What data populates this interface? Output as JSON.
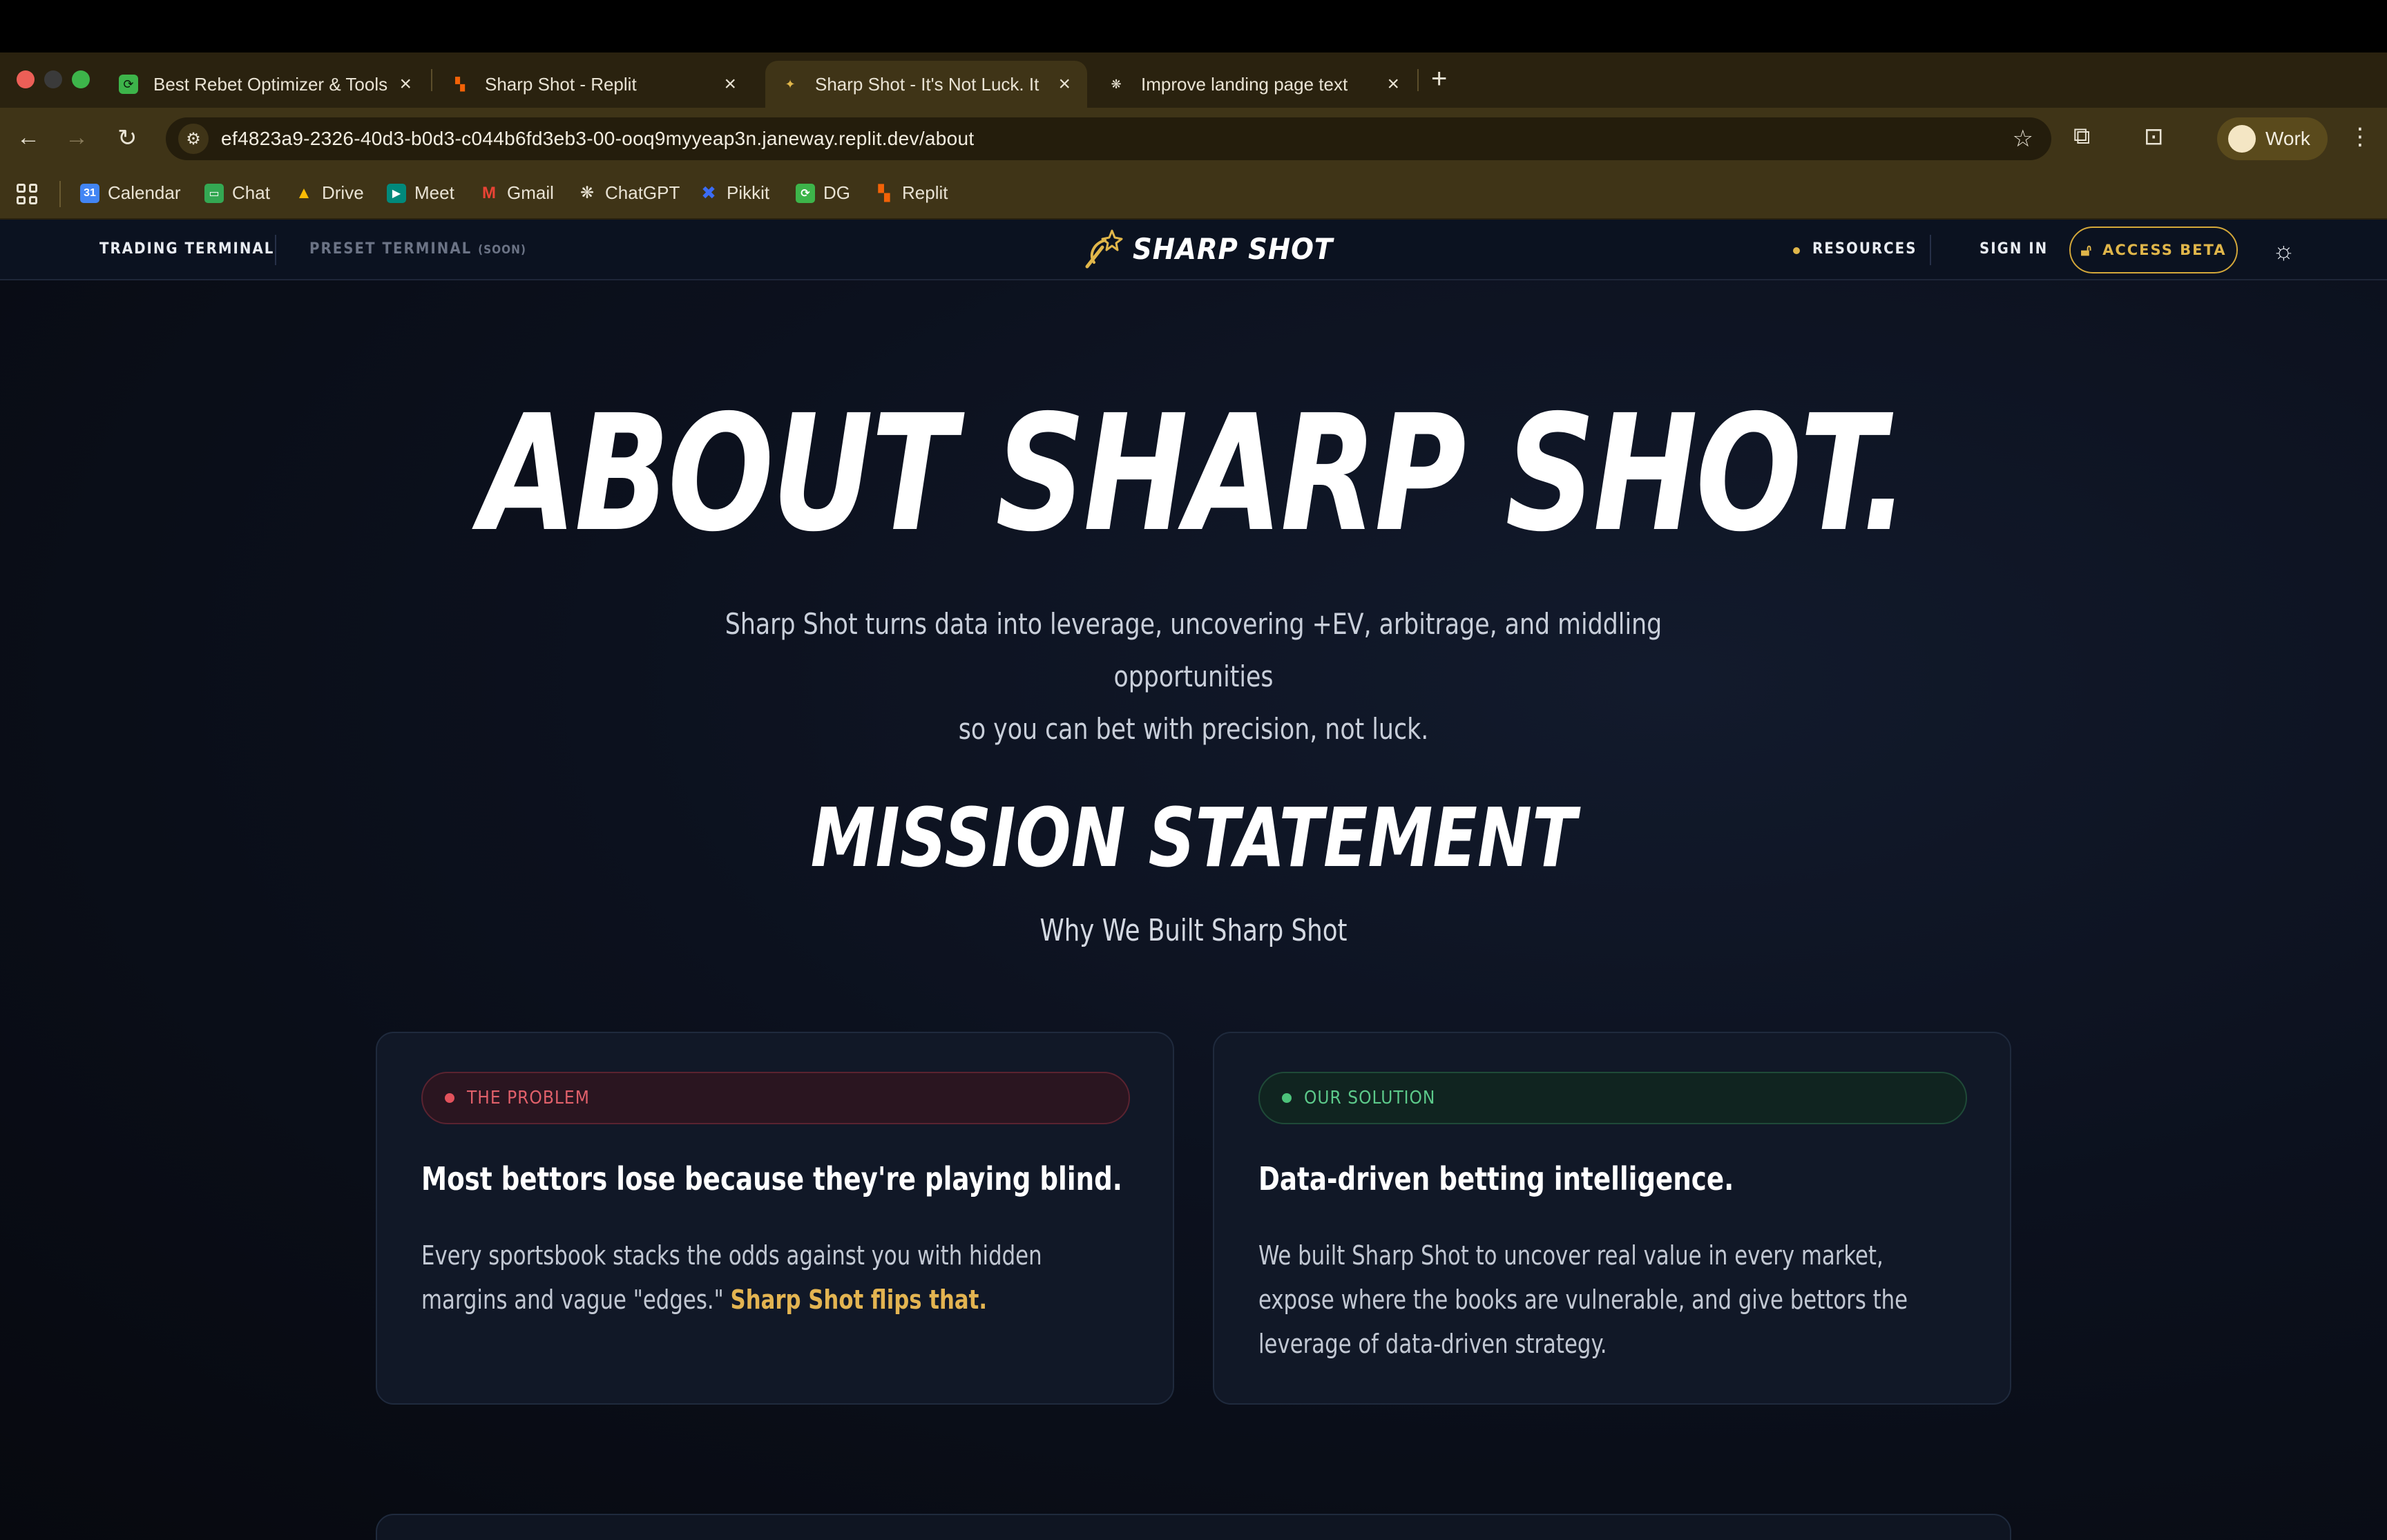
{
  "browser": {
    "tabs": [
      {
        "label": "Best Rebet Optimizer & Tools",
        "favicon": "rebet-favicon",
        "active": false
      },
      {
        "label": "Sharp Shot - Replit",
        "favicon": "replit-favicon",
        "active": false
      },
      {
        "label": "Sharp Shot - It's Not Luck. It",
        "favicon": "sharp-shot-favicon",
        "active": true
      },
      {
        "label": "Improve landing page text",
        "favicon": "chatgpt-favicon",
        "active": false
      }
    ],
    "url": "ef4823a9-2326-40d3-b0d3-c044b6fd3eb3-00-ooq9myyeap3n.janeway.replit.dev/about",
    "profile_label": "Work",
    "bookmarks": [
      {
        "label": "Calendar",
        "icon": "calendar-icon",
        "color": "#4285f4"
      },
      {
        "label": "Chat",
        "icon": "chat-icon",
        "color": "#34a853"
      },
      {
        "label": "Drive",
        "icon": "drive-icon",
        "color": "#fbbc04"
      },
      {
        "label": "Meet",
        "icon": "meet-icon",
        "color": "#00897b"
      },
      {
        "label": "Gmail",
        "icon": "gmail-icon",
        "color": "#ea4335"
      },
      {
        "label": "ChatGPT",
        "icon": "chatgpt-icon",
        "color": "#cccccc"
      },
      {
        "label": "Pikkit",
        "icon": "pikkit-icon",
        "color": "#3b6cf5"
      },
      {
        "label": "DG",
        "icon": "dg-icon",
        "color": "#3db44a"
      },
      {
        "label": "Replit",
        "icon": "replit-icon",
        "color": "#f26207"
      }
    ]
  },
  "site": {
    "nav": {
      "trading_terminal": "TRADING TERMINAL",
      "preset_terminal": "PRESET TERMINAL",
      "preset_terminal_badge": "(SOON)",
      "brand": "SHARP SHOT",
      "resources": "RESOURCES",
      "sign_in": "SIGN IN",
      "access_beta": "ACCESS BETA"
    },
    "hero": {
      "title": "ABOUT SHARP SHOT.",
      "subtitle_line1": "Sharp Shot turns data into leverage, uncovering +EV, arbitrage, and middling opportunities",
      "subtitle_line2": "so you can bet with precision, not luck."
    },
    "mission": {
      "title": "MISSION STATEMENT",
      "subtitle": "Why We Built Sharp Shot"
    },
    "cards": {
      "problem": {
        "pill": "THE PROBLEM",
        "heading": "Most bettors lose because they're playing blind.",
        "body": "Every sportsbook stacks the odds against you with hidden margins and vague \"edges.\" ",
        "highlight": "Sharp Shot flips that."
      },
      "solution": {
        "pill": "OUR SOLUTION",
        "heading": "Data-driven betting intelligence.",
        "body": "We built Sharp Shot to uncover real value in every market, expose where the books are vulnerable, and give bettors the leverage of data-driven strategy."
      }
    },
    "colors": {
      "accent_gold": "#e0b64a",
      "problem_red": "#e2525c",
      "solution_green": "#4cc27a",
      "background": "#0b1220"
    }
  }
}
